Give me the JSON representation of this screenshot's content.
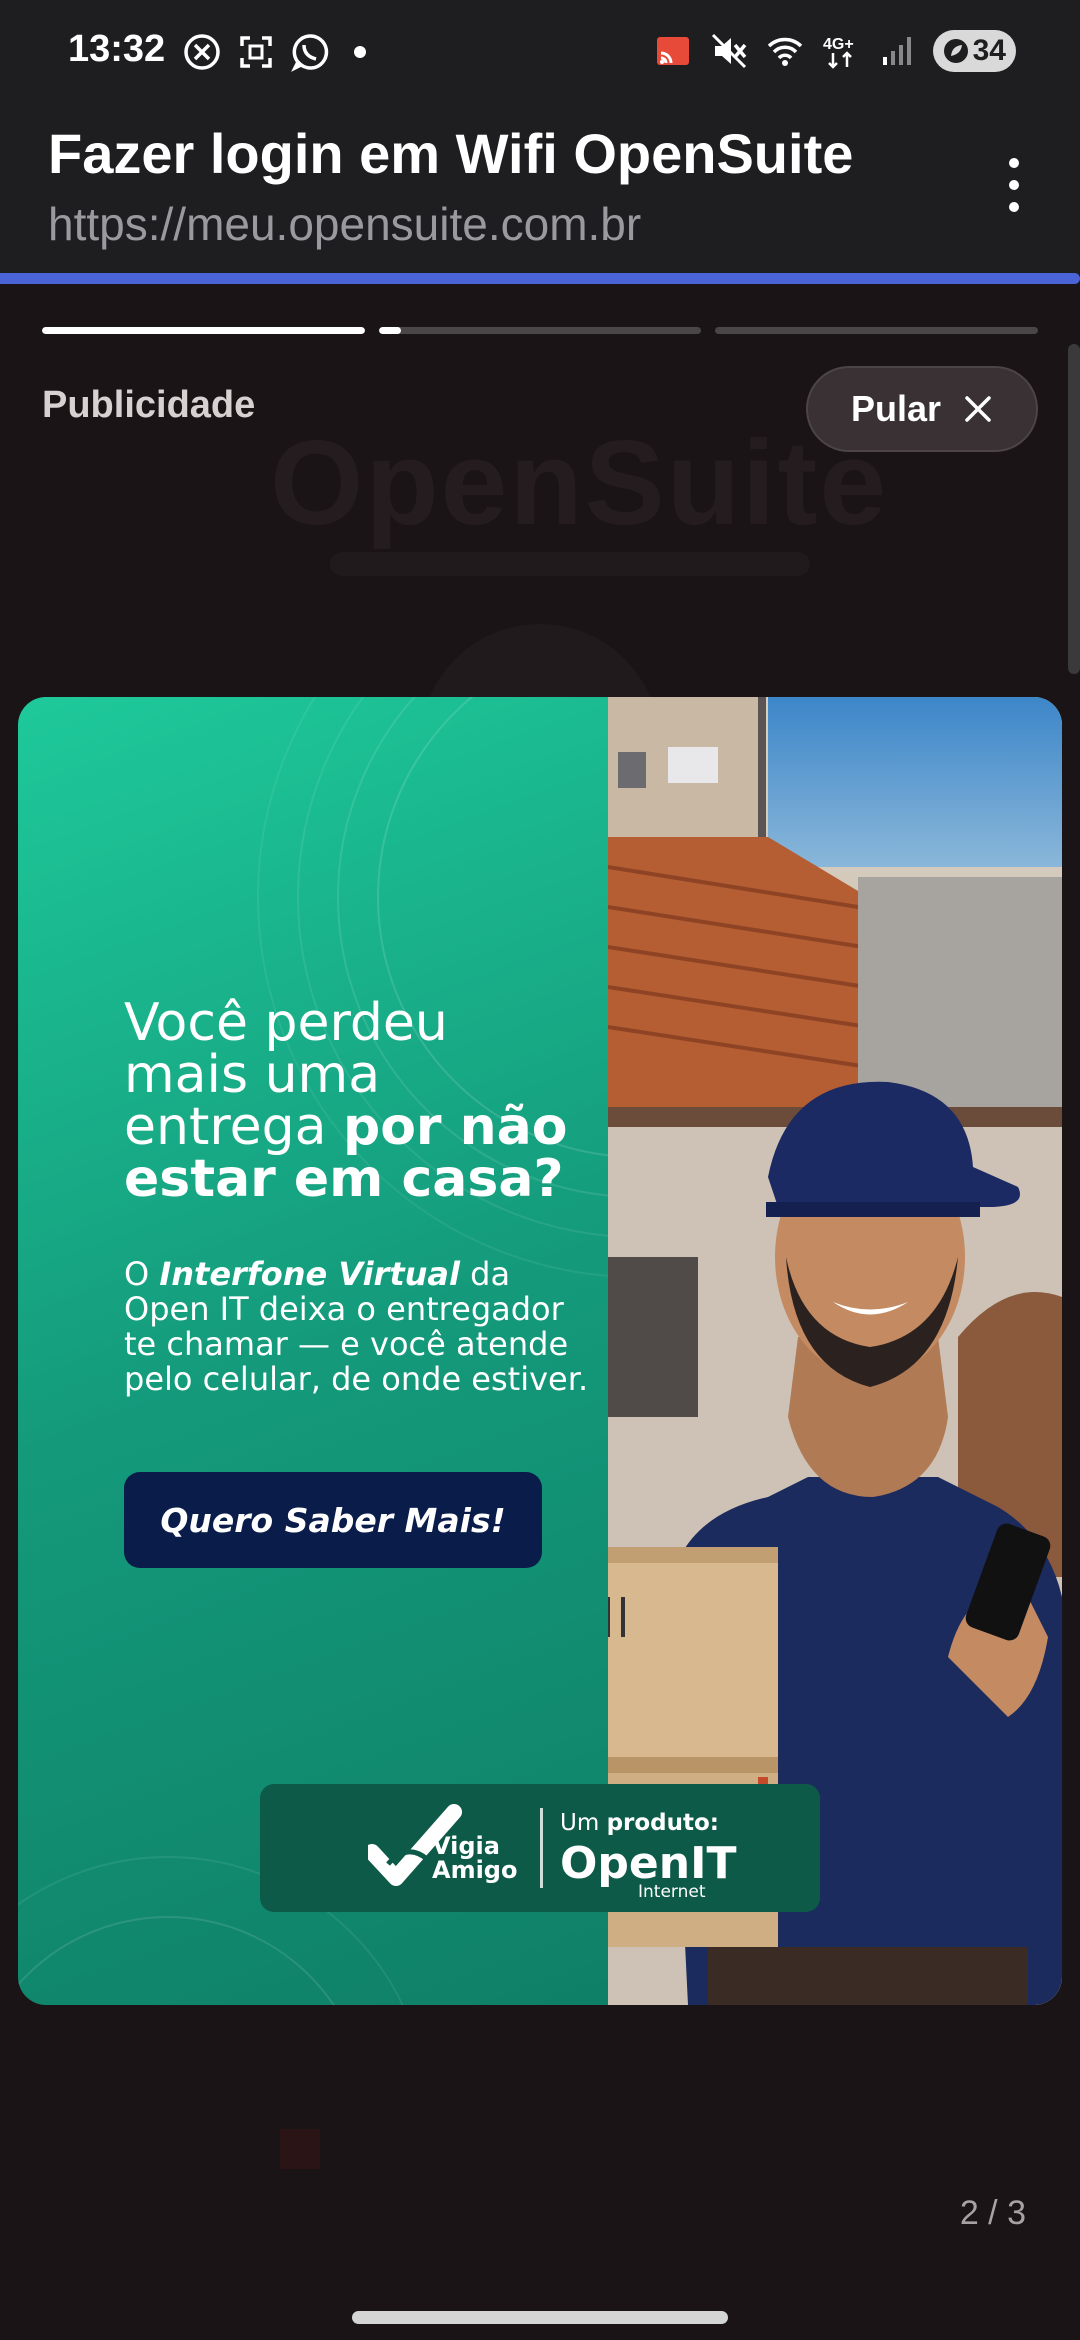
{
  "status_bar": {
    "time": "13:32",
    "left_icons": [
      "close-circle-icon",
      "screenshot-icon",
      "whatsapp-icon",
      "notification-dot-icon"
    ],
    "right_icons": [
      "cast-icon",
      "mute-icon",
      "wifi-icon",
      "network-4g-icon",
      "signal-icon"
    ],
    "network_label": "4G+",
    "battery": "34"
  },
  "browser": {
    "title": "Fazer login em Wifi OpenSuite",
    "url": "https://meu.opensuite.com.br",
    "menu_icon": "more-vertical-icon",
    "load_progress": 1.0
  },
  "story": {
    "segments": [
      {
        "progress": 1.0
      },
      {
        "progress": 0.07
      },
      {
        "progress": 0.0
      }
    ],
    "label": "Publicidade",
    "skip_label": "Pular",
    "skip_icon": "close-icon",
    "background_logo": "OpenSuite",
    "pager": "2 / 3"
  },
  "ad": {
    "headline_normal": "Você perdeu mais uma entrega ",
    "headline_bold": "por não estar em casa?",
    "body_pre": "O ",
    "body_bold": "Interfone Virtual",
    "body_post": " da Open IT deixa o entregador te chamar — e você atende pelo celular, de onde estiver.",
    "cta": "Quero Saber Mais!",
    "brand_left": "Vigia Amigo",
    "product_prefix": "Um ",
    "product_bold": "produto:",
    "brand_right": "OpenIT",
    "brand_right_sub": "Internet",
    "colors": {
      "teal": "#1ec99a",
      "dark_teal": "#0d5a48",
      "navy": "#0a1d4a"
    }
  }
}
